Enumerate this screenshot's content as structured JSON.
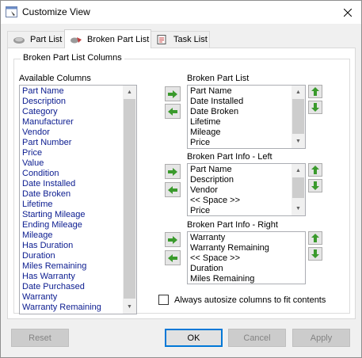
{
  "window": {
    "title": "Customize View"
  },
  "tabs": [
    {
      "label": "Part List"
    },
    {
      "label": "Broken Part List"
    },
    {
      "label": "Task List"
    }
  ],
  "group": {
    "title": "Broken Part List Columns"
  },
  "available": {
    "label": "Available Columns",
    "items": [
      "Part Name",
      "Description",
      "Category",
      "Manufacturer",
      "Vendor",
      "Part Number",
      "Price",
      "Value",
      "Condition",
      "Date Installed",
      "Date Broken",
      "Lifetime",
      "Starting Mileage",
      "Ending Mileage",
      "Mileage",
      "Has Duration",
      "Duration",
      "Miles Remaining",
      "Has Warranty",
      "Date Purchased",
      "Warranty",
      "Warranty Remaining"
    ]
  },
  "broken_list": {
    "label": "Broken Part List",
    "items": [
      "Part Name",
      "Date Installed",
      "Date Broken",
      "Lifetime",
      "Mileage",
      "Price"
    ]
  },
  "info_left": {
    "label": "Broken Part Info - Left",
    "items": [
      "Part Name",
      "Description",
      "Vendor",
      "<< Space >>",
      "Price"
    ]
  },
  "info_right": {
    "label": "Broken Part Info - Right",
    "items": [
      "Warranty",
      "Warranty Remaining",
      "<< Space >>",
      "Duration",
      "Miles Remaining"
    ]
  },
  "autosize": {
    "label": "Always autosize columns to fit contents",
    "checked": false
  },
  "buttons": {
    "reset": "Reset",
    "ok": "OK",
    "cancel": "Cancel",
    "apply": "Apply"
  },
  "colors": {
    "list_text": "#0a1b8f",
    "arrow_green": "#3a9a2c",
    "focus_blue": "#0078d7"
  }
}
